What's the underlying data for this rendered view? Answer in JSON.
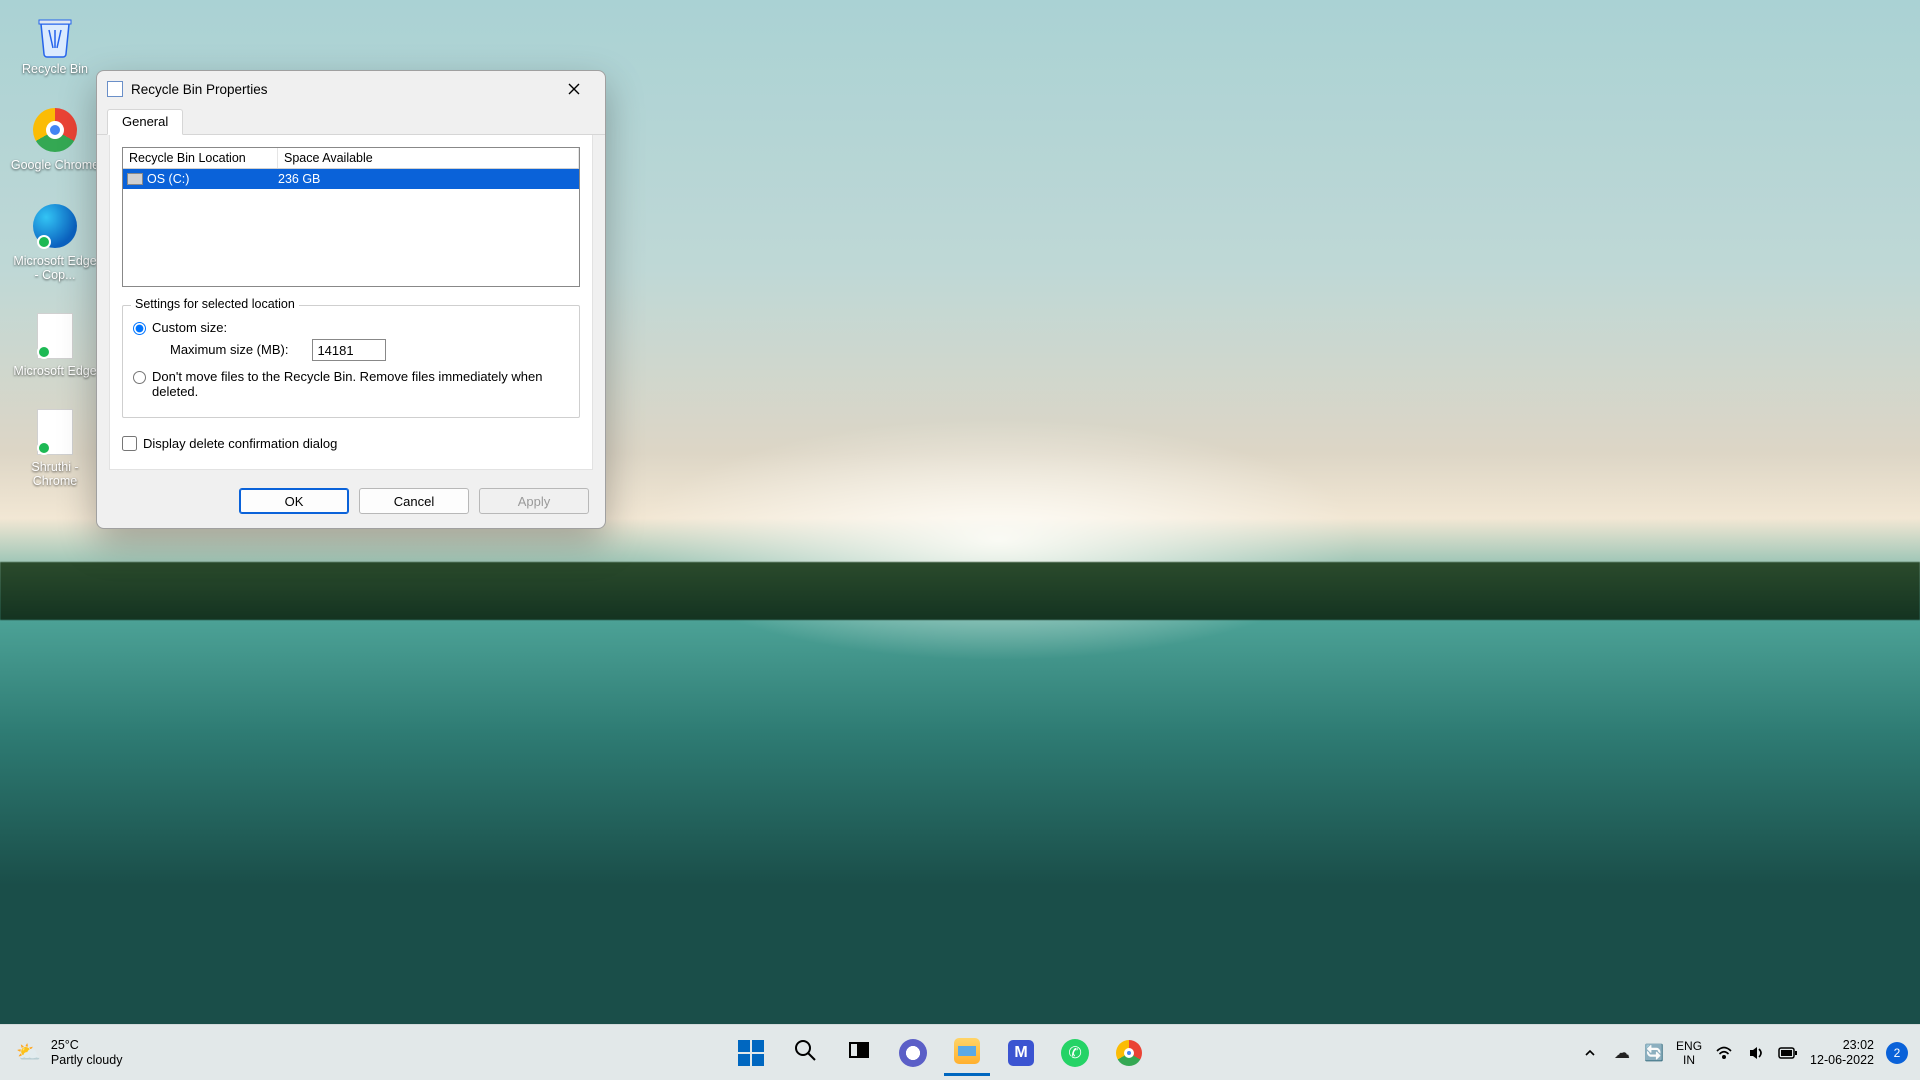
{
  "desktop": {
    "icons": [
      {
        "label": "Recycle Bin"
      },
      {
        "label": "Google Chrome"
      },
      {
        "label": "Microsoft Edge - Cop..."
      },
      {
        "label": "Microsoft Edge"
      },
      {
        "label": "Shruthi - Chrome"
      }
    ]
  },
  "dialog": {
    "title": "Recycle Bin Properties",
    "tab": "General",
    "columns": {
      "location": "Recycle Bin Location",
      "space": "Space Available"
    },
    "row": {
      "location": "OS (C:)",
      "space": "236 GB"
    },
    "group_legend": "Settings for selected location",
    "custom_size_label": "Custom size:",
    "max_size_label": "Maximum size (MB):",
    "max_size_value": "14181",
    "dont_move_label": "Don't move files to the Recycle Bin. Remove files immediately when deleted.",
    "confirm_label": "Display delete confirmation dialog",
    "buttons": {
      "ok": "OK",
      "cancel": "Cancel",
      "apply": "Apply"
    }
  },
  "taskbar": {
    "weather_temp": "25°C",
    "weather_desc": "Partly cloudy",
    "lang_top": "ENG",
    "lang_bottom": "IN",
    "time": "23:02",
    "date": "12-06-2022",
    "notifications": "2"
  }
}
